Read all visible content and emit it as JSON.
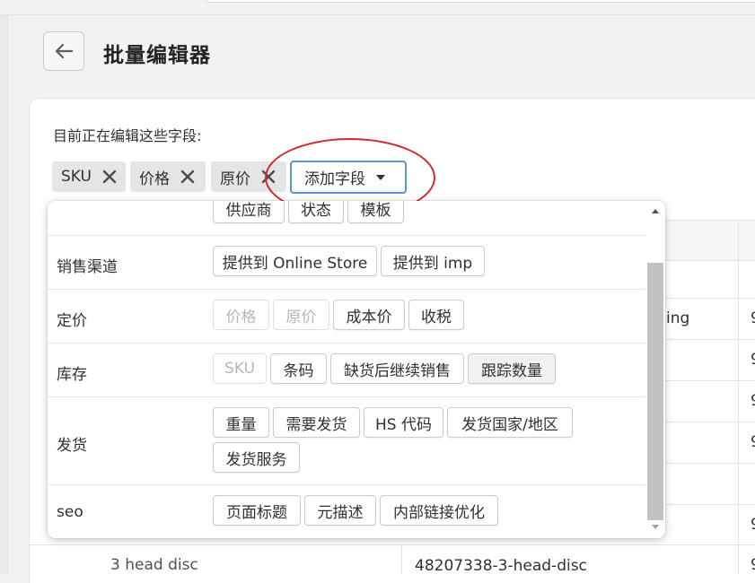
{
  "page": {
    "title": "批量编辑器"
  },
  "editor": {
    "editing_label": "目前正在编辑这些字段:",
    "chips": [
      {
        "label": "SKU"
      },
      {
        "label": "价格"
      },
      {
        "label": "原价"
      }
    ],
    "add_field_label": "添加字段"
  },
  "background_table": {
    "partial_cell": "ing",
    "bottom_row": {
      "title": "3 head disc",
      "handle": "48207338-3-head-disc"
    },
    "edge_char": "9"
  },
  "dropdown": {
    "top_partial_options": [
      "供应商",
      "状态",
      "模板"
    ],
    "groups": [
      {
        "label": "销售渠道",
        "options": [
          "提供到 Online Store",
          "提供到 imp"
        ]
      },
      {
        "label": "定价",
        "options": [
          "价格",
          "原价",
          "成本价",
          "收税"
        ]
      },
      {
        "label": "库存",
        "options": [
          "SKU",
          "条码",
          "缺货后继续销售",
          "跟踪数量"
        ]
      },
      {
        "label": "发货",
        "options": [
          "重量",
          "需要发货",
          "HS 代码",
          "发货国家/地区",
          "发货服务"
        ]
      },
      {
        "label": "seo",
        "options": [
          "页面标题",
          "元描述",
          "内部链接优化"
        ]
      }
    ]
  }
}
